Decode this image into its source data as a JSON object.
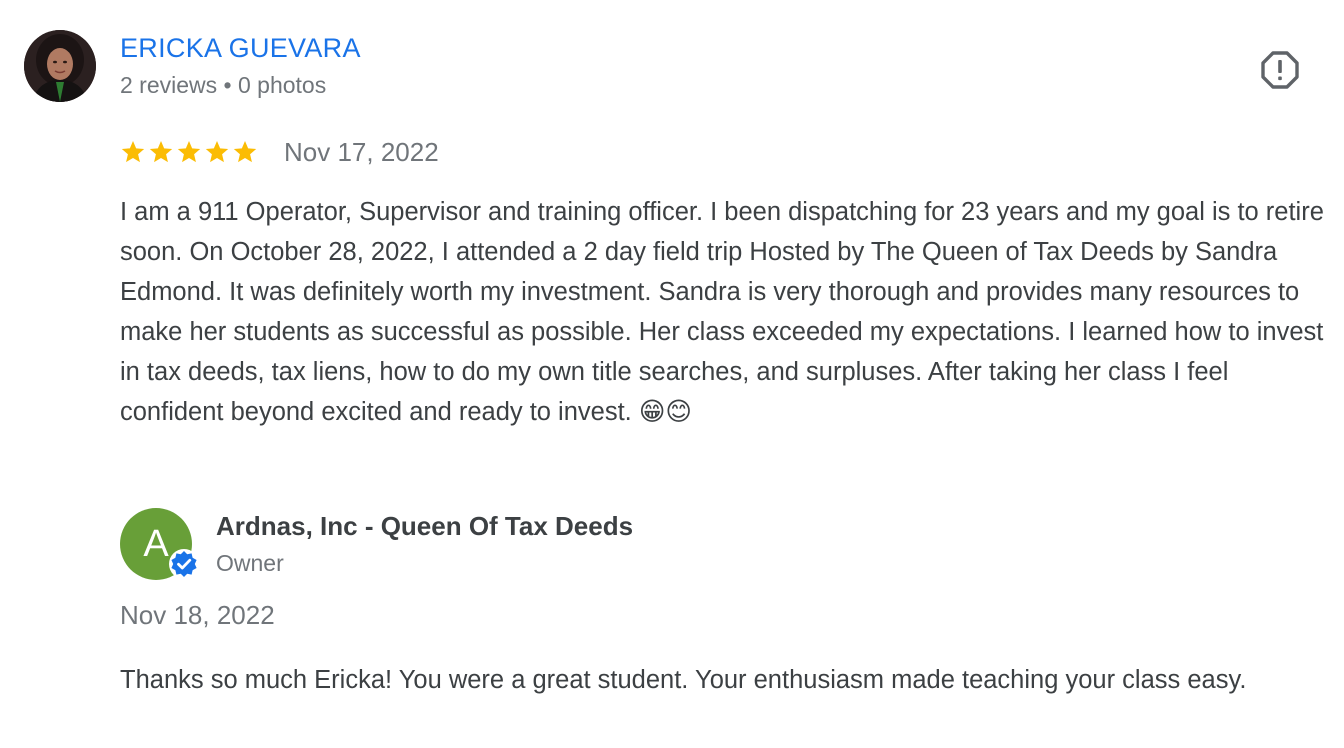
{
  "reviewer": {
    "name": "ERICKA GUEVARA",
    "meta": "2 reviews • 0 photos"
  },
  "review": {
    "rating": 5,
    "rating_max": 5,
    "star_color": "#fbbc04",
    "date": "Nov 17, 2022",
    "text": "I am a 911 Operator, Supervisor and training officer. I been dispatching for 23 years and my goal is to retire soon. On October 28, 2022, I attended a 2 day field trip Hosted by The Queen of Tax Deeds by Sandra Edmond. It was definitely worth my investment. Sandra is very thorough and provides many resources to make her students as successful as possible. Her class exceeded my expectations. I learned how to invest in tax deeds, tax liens, how to do my own title searches, and surpluses. After taking her class I feel confident beyond excited and ready to invest. 😁😊"
  },
  "owner_reply": {
    "avatar_letter": "A",
    "avatar_color": "#689f38",
    "name": "Ardnas, Inc - Queen Of Tax Deeds",
    "role": "Owner",
    "date": "Nov 18, 2022",
    "text": "Thanks so much Ericka! You were a great student. Your enthusiasm made teaching your class easy."
  },
  "icons": {
    "report": "report-flag-icon",
    "verified": "verified-badge-icon",
    "star": "star-icon"
  },
  "colors": {
    "link": "#1a73e8",
    "secondary_text": "#70757a",
    "body_text": "#3c4043",
    "verified": "#1a73e8"
  }
}
